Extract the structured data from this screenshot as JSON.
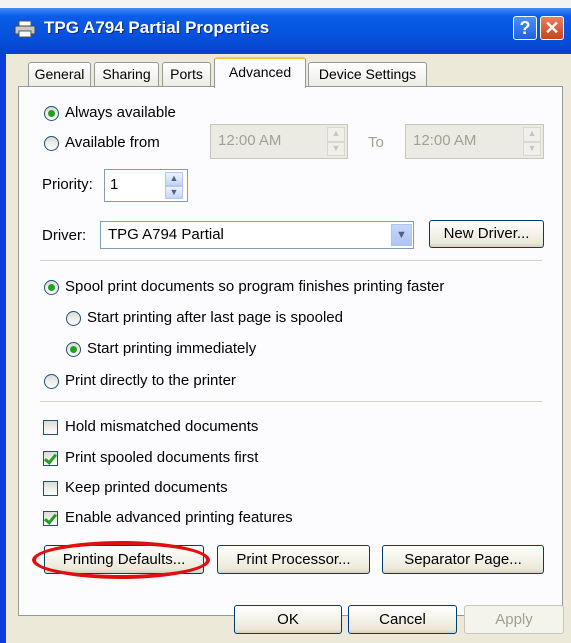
{
  "backdrop": {
    "fragments": [
      "​",
      "​"
    ]
  },
  "window": {
    "title": "TPG A794 Partial Properties",
    "help_button": "?",
    "close_button": "✕"
  },
  "tabs": [
    {
      "label": "General",
      "active": false
    },
    {
      "label": "Sharing",
      "active": false
    },
    {
      "label": "Ports",
      "active": false
    },
    {
      "label": "Advanced",
      "active": true
    },
    {
      "label": "Device Settings",
      "active": false
    }
  ],
  "availability": {
    "always_label": "Always available",
    "always_selected": true,
    "from_label": "Available from",
    "from_time": "12:00 AM",
    "to_label": "To",
    "to_time": "12:00 AM"
  },
  "priority": {
    "label": "Priority:",
    "value": "1"
  },
  "driver": {
    "label": "Driver:",
    "value": "TPG A794 Partial",
    "new_driver_button": "New Driver..."
  },
  "spool": {
    "spool_label": "Spool print documents so program finishes printing faster",
    "spool_selected": true,
    "after_last_label": "Start printing after last page is spooled",
    "after_last_selected": false,
    "immediately_label": "Start printing immediately",
    "immediately_selected": true,
    "direct_label": "Print directly to the printer",
    "direct_selected": false
  },
  "options": {
    "hold_mismatched": {
      "label": "Hold mismatched documents",
      "checked": false
    },
    "spooled_first": {
      "label": "Print spooled documents first",
      "checked": true
    },
    "keep_printed": {
      "label": "Keep printed documents",
      "checked": false
    },
    "advanced_features": {
      "label": "Enable advanced printing features",
      "checked": true
    }
  },
  "buttons": {
    "printing_defaults": "Printing Defaults...",
    "print_processor": "Print Processor...",
    "separator_page": "Separator Page...",
    "ok": "OK",
    "cancel": "Cancel",
    "apply": "Apply"
  },
  "colors": {
    "title_bar": "#0653e0",
    "dialog_bg": "#ece9d8",
    "radio_dot": "#21a121",
    "highlight_circle": "#e01010",
    "active_tab_accent": "#ffc83c"
  }
}
